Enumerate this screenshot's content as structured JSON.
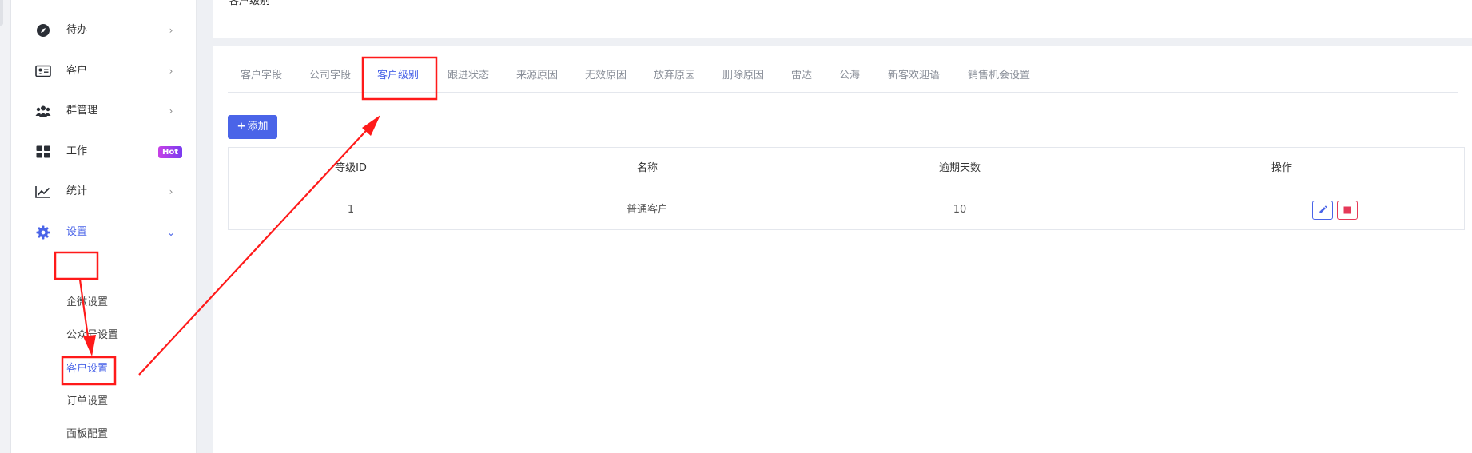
{
  "sidebar": {
    "items": [
      {
        "label": "待办",
        "icon": "compass-icon"
      },
      {
        "label": "客户",
        "icon": "contact-card-icon"
      },
      {
        "label": "群管理",
        "icon": "group-icon"
      },
      {
        "label": "工作",
        "icon": "grid-icon",
        "badge": "Hot"
      },
      {
        "label": "统计",
        "icon": "line-chart-icon"
      },
      {
        "label": "设置",
        "icon": "gear-icon"
      }
    ],
    "settings_sub": [
      {
        "label": "企微设置"
      },
      {
        "label": "公众号设置"
      },
      {
        "label": "客户设置"
      },
      {
        "label": "订单设置"
      },
      {
        "label": "面板配置"
      }
    ]
  },
  "header": {
    "breadcrumb": "客户级别"
  },
  "tabs": [
    {
      "label": "客户字段"
    },
    {
      "label": "公司字段"
    },
    {
      "label": "客户级别"
    },
    {
      "label": "跟进状态"
    },
    {
      "label": "来源原因"
    },
    {
      "label": "无效原因"
    },
    {
      "label": "放弃原因"
    },
    {
      "label": "删除原因"
    },
    {
      "label": "雷达"
    },
    {
      "label": "公海"
    },
    {
      "label": "新客欢迎语"
    },
    {
      "label": "销售机会设置"
    }
  ],
  "toolbar": {
    "add_label": "添加"
  },
  "table": {
    "columns": [
      "等级ID",
      "名称",
      "逾期天数",
      "操作"
    ],
    "rows": [
      {
        "id": "1",
        "name": "普通客户",
        "overdue_days": "10"
      }
    ]
  },
  "colors": {
    "accent": "#4a64e8",
    "danger": "#e53958",
    "annotation": "#ff1a1a",
    "hot_badge": "#c740e6"
  }
}
